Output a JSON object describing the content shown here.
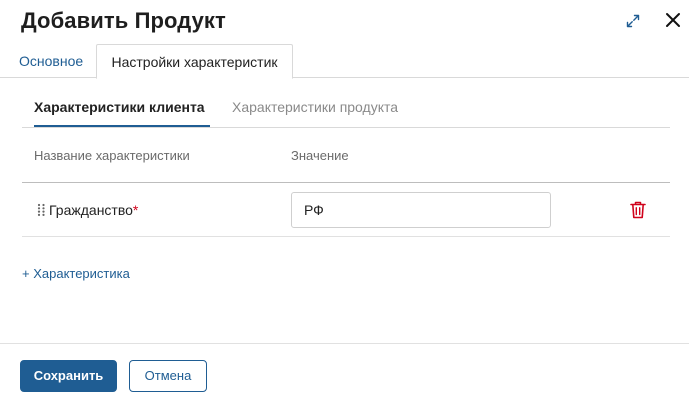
{
  "dialog": {
    "title": "Добавить Продукт",
    "icons": {
      "expand": "expand-arrows-icon",
      "close": "close-x-icon"
    }
  },
  "tabs": [
    {
      "label": "Основное",
      "active": false
    },
    {
      "label": "Настройки характеристик",
      "active": true
    }
  ],
  "subtabs": [
    {
      "label": "Характеристики клиента",
      "active": true
    },
    {
      "label": "Характеристики продукта",
      "active": false
    }
  ],
  "table": {
    "columns": [
      "Название характеристики",
      "Значение"
    ],
    "rows": [
      {
        "name": "Гражданство",
        "required_mark": "*",
        "value": "РФ",
        "icons": {
          "drag": "drag-handle-icon",
          "delete": "trash-icon"
        }
      }
    ]
  },
  "add_characteristic_label": "+ Характеристика",
  "footer": {
    "save_label": "Сохранить",
    "cancel_label": "Отмена"
  },
  "colors": {
    "accent": "#1f5d93",
    "danger": "#d0021b",
    "border": "#d9d9d9",
    "muted_text": "#8a8a8a"
  }
}
